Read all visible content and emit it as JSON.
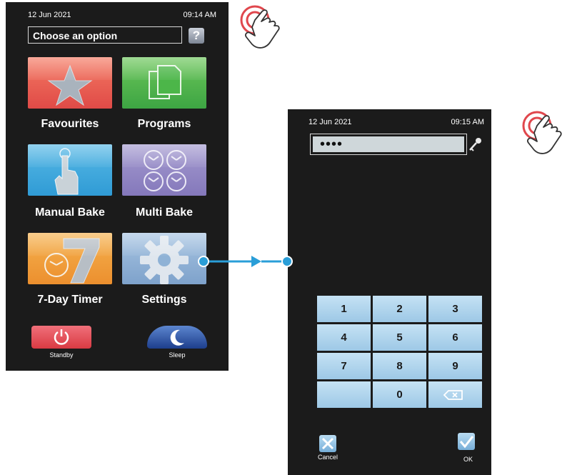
{
  "colors": {
    "screen_bg": "#1b1b1b",
    "favourites": "#ea5a52",
    "programs": "#4cb649",
    "manual_bake": "#3ba6dc",
    "multi_bake": "#8f84c2",
    "timer": "#ef9a3a",
    "settings": "#8fb2d6",
    "standby": "#e0474d",
    "sleep": "#284ea0",
    "connector": "#2a9ed8",
    "key": "#b3d7ef"
  },
  "screen1": {
    "date": "12 Jun 2021",
    "time": "09:14 AM",
    "title": "Choose an option",
    "help": "?",
    "tiles": [
      {
        "label": "Favourites",
        "icon": "star-icon"
      },
      {
        "label": "Programs",
        "icon": "documents-icon"
      },
      {
        "label": "Manual Bake",
        "icon": "hand-pointer-icon"
      },
      {
        "label": "Multi Bake",
        "icon": "four-clocks-icon"
      },
      {
        "label": "7-Day Timer",
        "icon": "seven-day-clock-icon"
      },
      {
        "label": "Settings",
        "icon": "gear-icon"
      }
    ],
    "standby": {
      "label": "Standby",
      "icon": "power-icon"
    },
    "sleep": {
      "label": "Sleep",
      "icon": "moon-icon"
    }
  },
  "screen2": {
    "date": "12 Jun 2021",
    "time": "09:15 AM",
    "password_mask": "••••",
    "keypad": [
      "1",
      "2",
      "3",
      "4",
      "5",
      "6",
      "7",
      "8",
      "9",
      "",
      "0",
      "⌫"
    ],
    "cancel": {
      "label": "Cancel",
      "icon": "x-icon"
    },
    "ok": {
      "label": "OK",
      "icon": "check-icon"
    }
  }
}
